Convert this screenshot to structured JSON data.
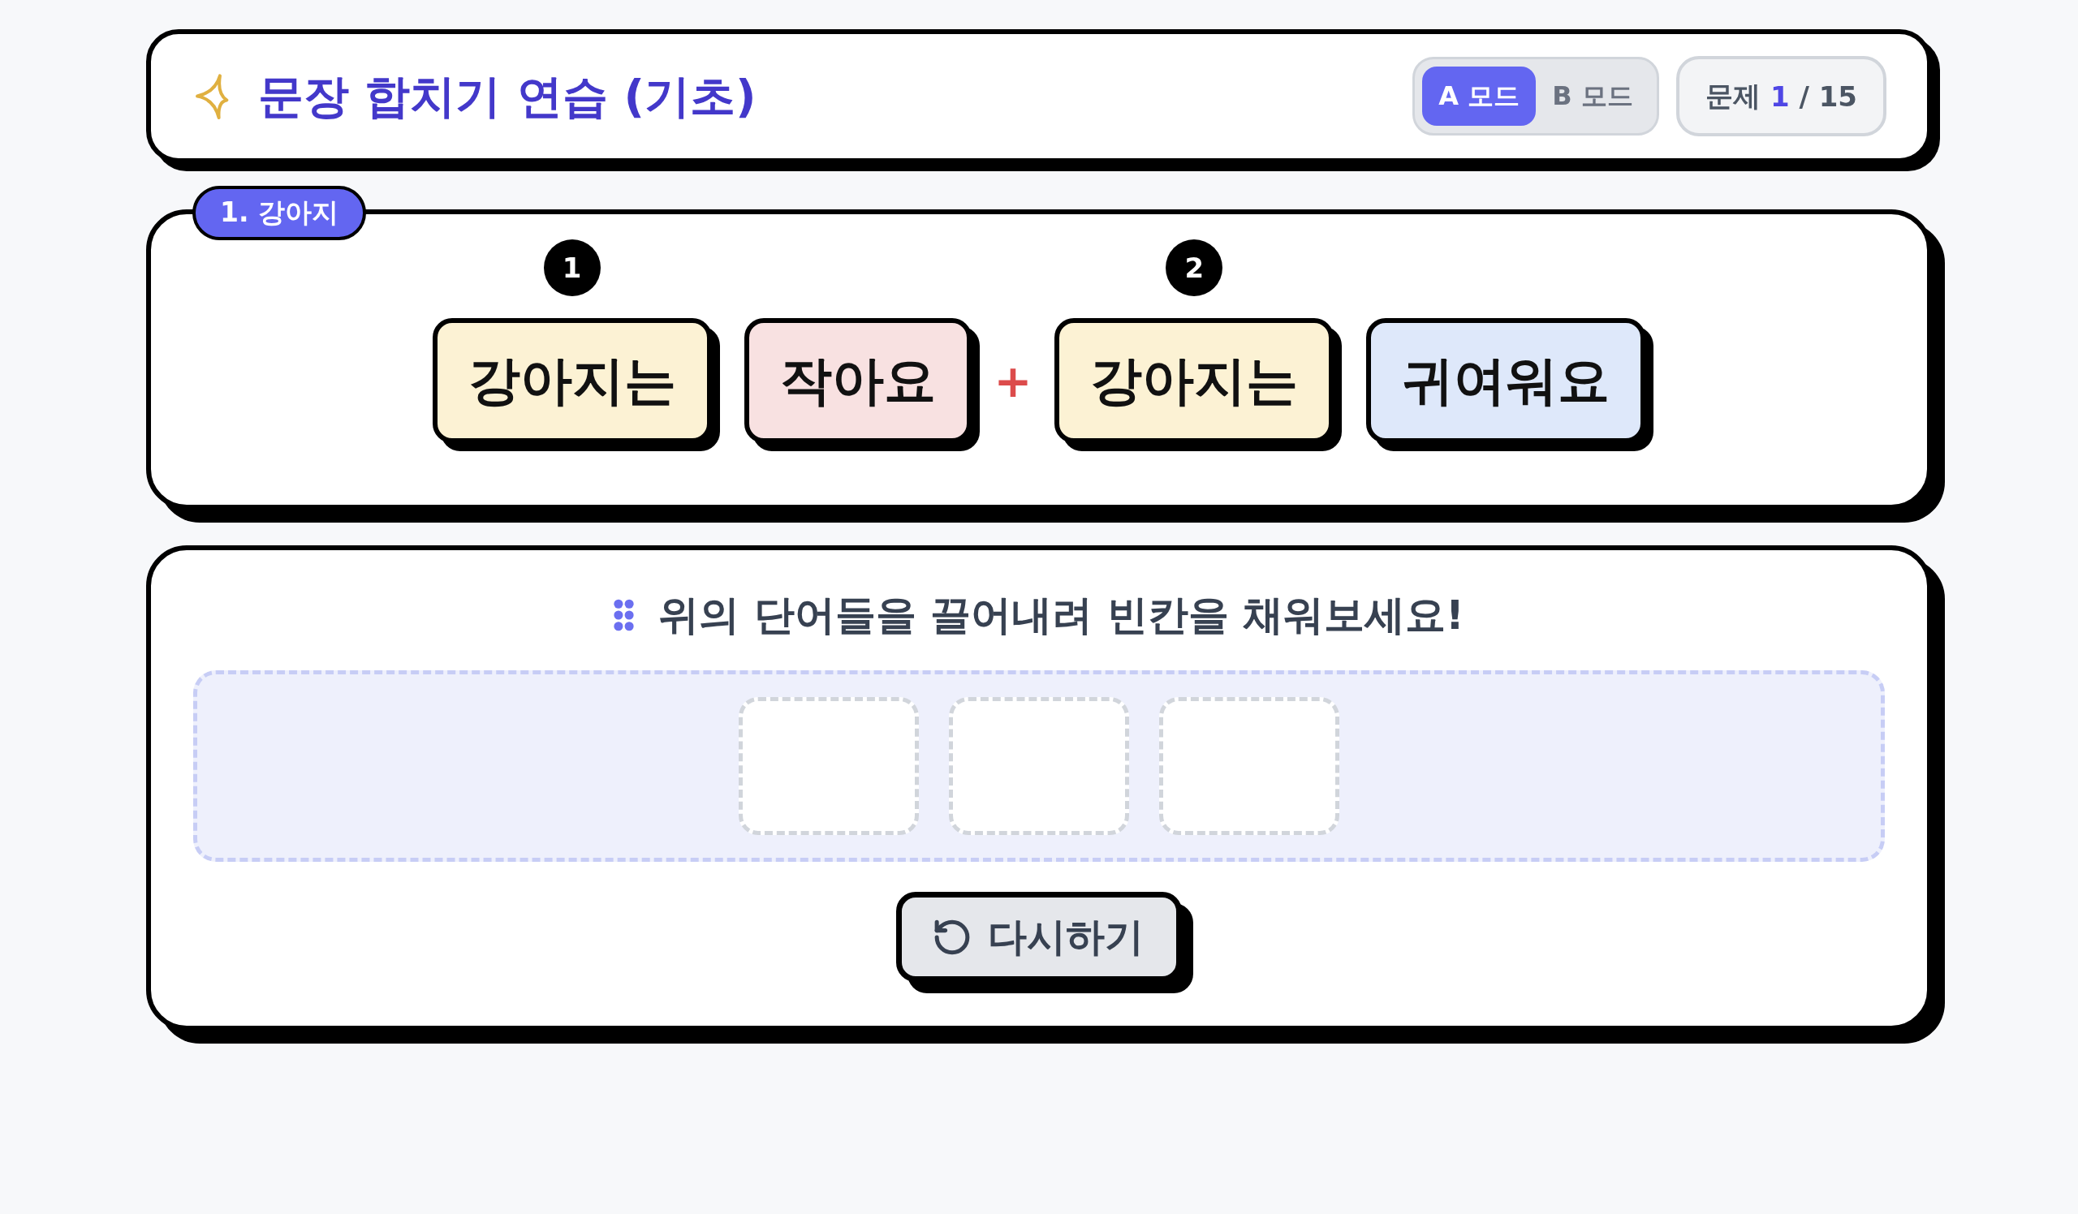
{
  "header": {
    "title": "문장 합치기 연습 (기초)",
    "modes": [
      {
        "label": "A 모드",
        "selected": true
      },
      {
        "label": "B 모드",
        "selected": false
      }
    ],
    "counter": "문제 **1** / 15"
  },
  "sentence_card": {
    "tag": "1. 강아지",
    "groups": [
      {
        "badge": "1",
        "words": [
          {
            "text": "강아지는",
            "color": "#fcf2d4"
          },
          {
            "text": "작아요",
            "color": "#f8e1e1"
          }
        ]
      },
      {
        "badge": "2",
        "words": [
          {
            "text": "강아지는",
            "color": "#fcf2d4"
          },
          {
            "text": "귀여워요",
            "color": "#dee8fa"
          }
        ]
      }
    ],
    "connector": "+"
  },
  "answer_card": {
    "instruction": "위의 단어들을 끌어내려 빈칸을 채워보세요!",
    "slots": [
      {
        "filled": false
      },
      {
        "filled": false
      },
      {
        "filled": false
      }
    ],
    "retry_button": "다시하기"
  }
}
